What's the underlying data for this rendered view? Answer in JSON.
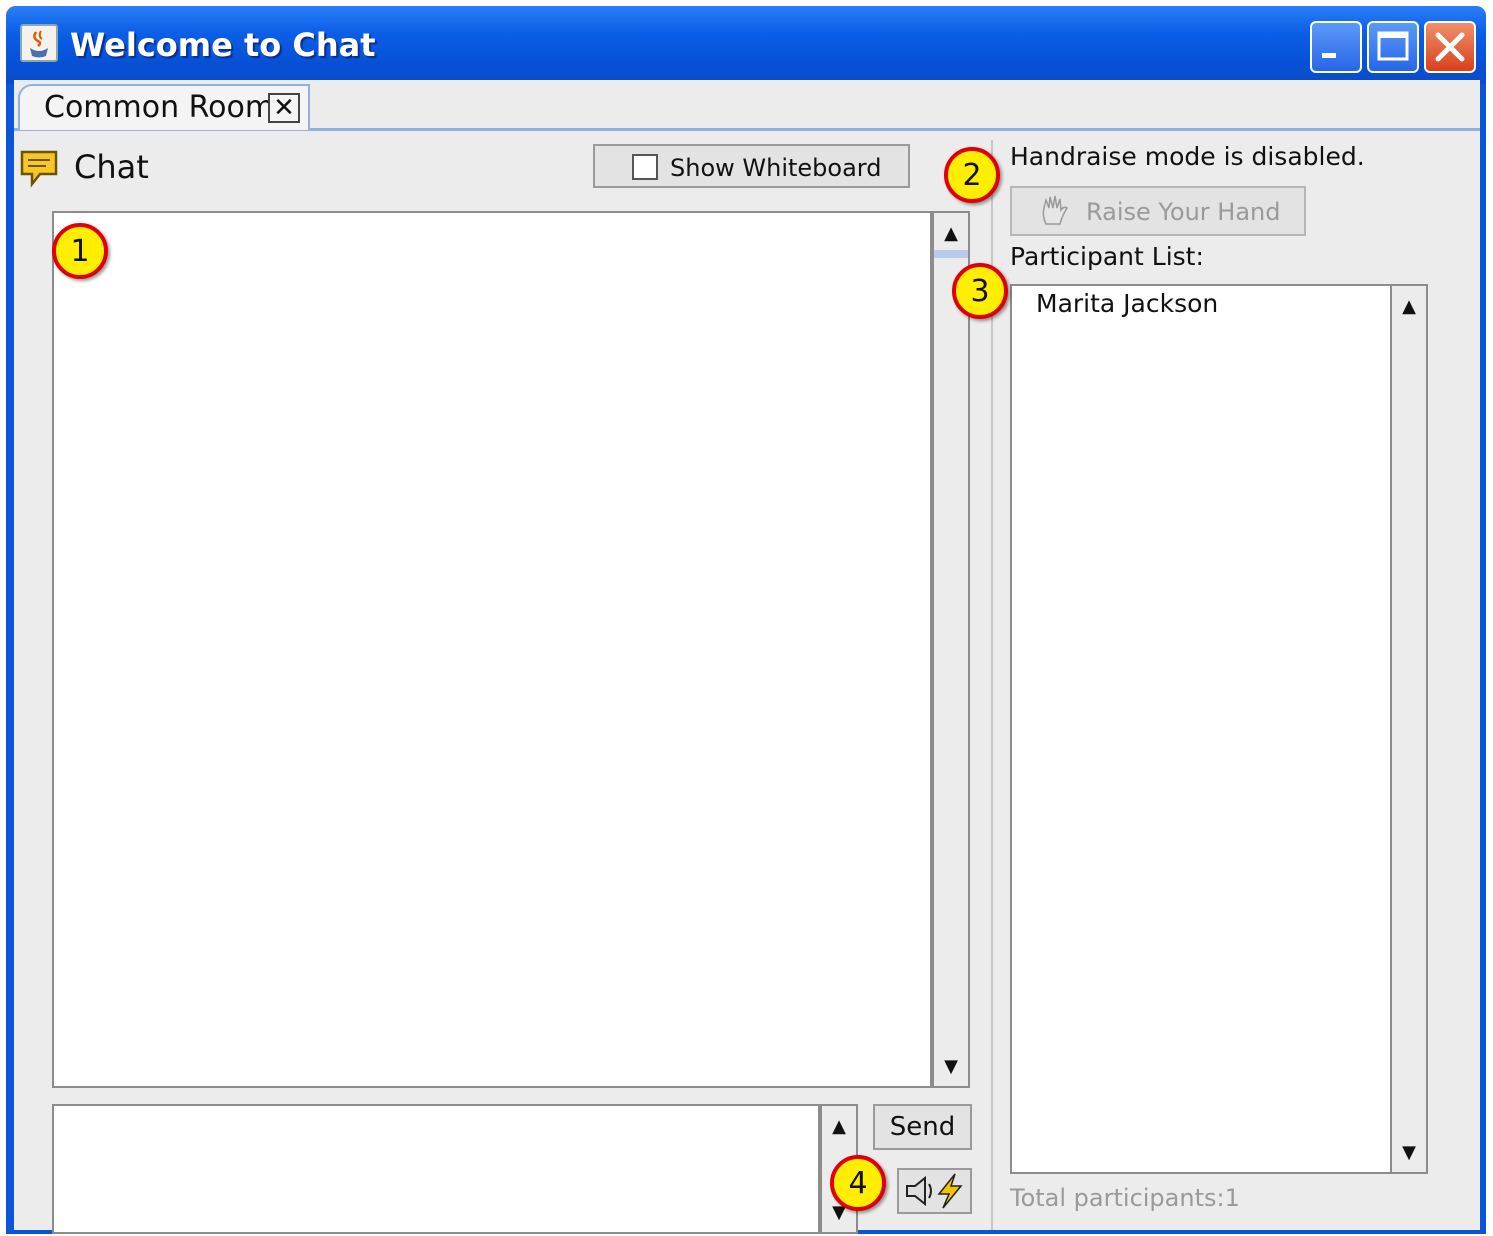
{
  "window": {
    "title": "Welcome to Chat",
    "app_icon": "java-cup-icon",
    "controls": [
      "minimize-icon",
      "maximize-icon",
      "close-icon"
    ]
  },
  "tabs": [
    {
      "label": "Common Room",
      "close_symbol": "✕"
    }
  ],
  "chat_panel": {
    "icon": "chat-bubble-icon",
    "label": "Chat",
    "whiteboard_label": "Show Whiteboard",
    "whiteboard_checked": false,
    "send_label": "Send",
    "sound_icon": "sound-lightning-icon"
  },
  "side_panel": {
    "handraise_status": "Handraise mode is disabled.",
    "raise_hand_label": "Raise Your Hand",
    "raise_hand_enabled": false,
    "participant_list_label": "Participant List:",
    "participants": [
      "Marita Jackson"
    ],
    "total_participants": "Total participants:1"
  },
  "callouts": [
    "1",
    "2",
    "3",
    "4"
  ],
  "colors": {
    "titlebar": "#0b5ee6",
    "client_bg": "#ececec",
    "callout_fill": "#ffee00",
    "callout_border": "#e00000",
    "close_button": "#d8401c"
  }
}
